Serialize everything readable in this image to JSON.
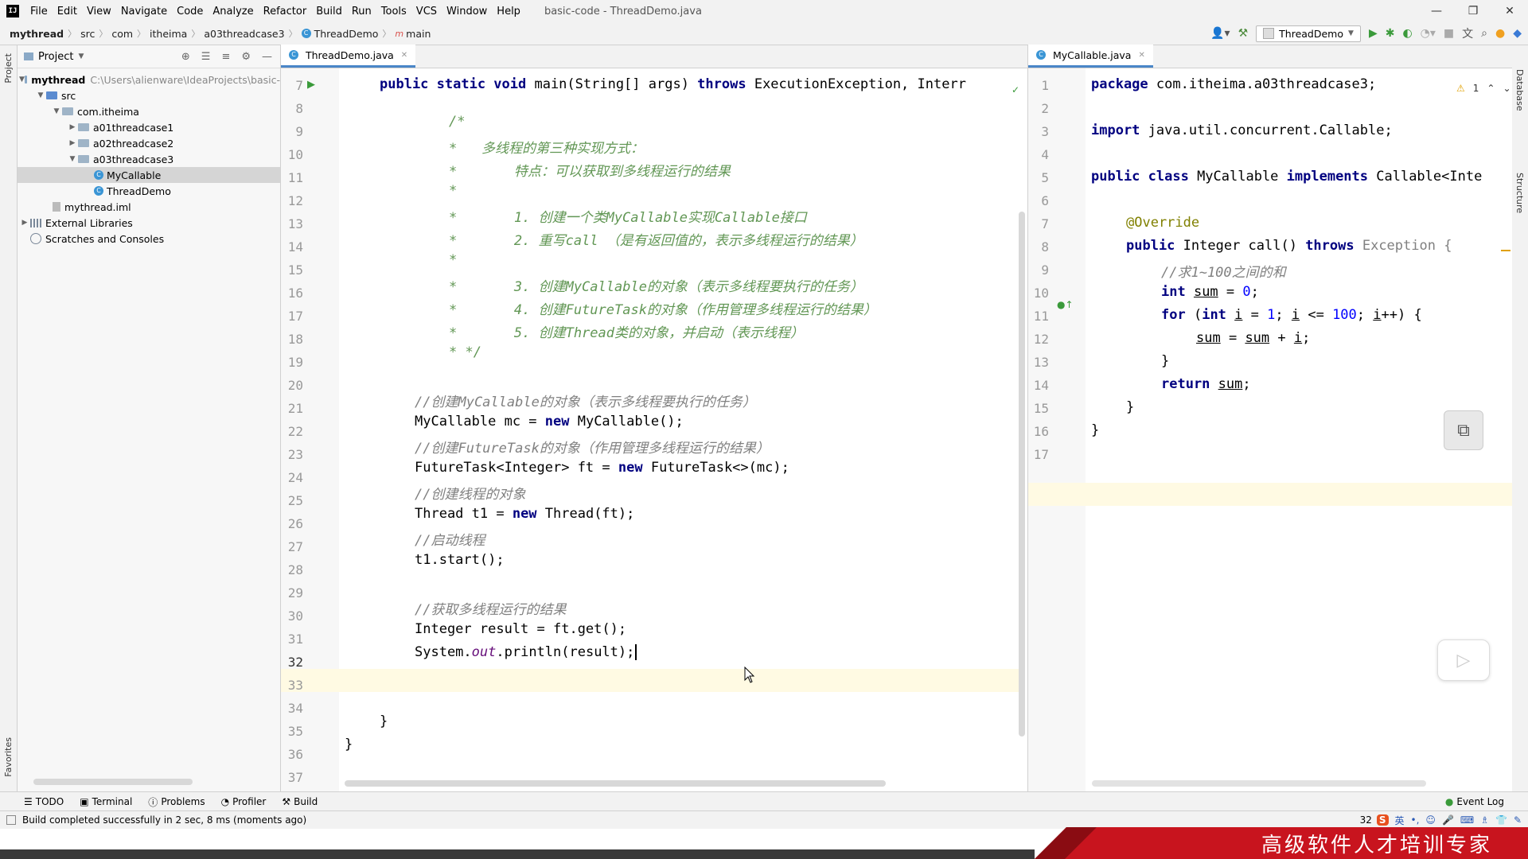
{
  "menubar": {
    "items": [
      "File",
      "Edit",
      "View",
      "Navigate",
      "Code",
      "Analyze",
      "Refactor",
      "Build",
      "Run",
      "Tools",
      "VCS",
      "Window",
      "Help"
    ],
    "window_title": "basic-code - ThreadDemo.java"
  },
  "breadcrumb": [
    "mythread",
    "src",
    "com",
    "itheima",
    "a03threadcase3",
    "ThreadDemo",
    "main"
  ],
  "run_config": "ThreadDemo",
  "project": {
    "title": "Project",
    "tree": [
      {
        "label": "mythread",
        "path": "C:\\Users\\alienware\\IdeaProjects\\basic-"
      },
      {
        "label": "src"
      },
      {
        "label": "com.itheima"
      },
      {
        "label": "a01threadcase1"
      },
      {
        "label": "a02threadcase2"
      },
      {
        "label": "a03threadcase3"
      },
      {
        "label": "MyCallable"
      },
      {
        "label": "ThreadDemo"
      },
      {
        "label": "mythread.iml"
      },
      {
        "label": "External Libraries"
      },
      {
        "label": "Scratches and Consoles"
      }
    ]
  },
  "left_editor": {
    "tab": "ThreadDemo.java",
    "line_numbers": [
      "7",
      "8",
      "9",
      "10",
      "11",
      "12",
      "13",
      "14",
      "15",
      "16",
      "17",
      "18",
      "19",
      "20",
      "21",
      "22",
      "23",
      "24",
      "25",
      "26",
      "27",
      "28",
      "29",
      "30",
      "31",
      "32",
      "33",
      "34",
      "35",
      "36",
      "37"
    ],
    "lines": {
      "l7a": "public static void ",
      "l7b": "main(String[] args) ",
      "l7c": "throws ",
      "l7d": "ExecutionException, Interr",
      "l9": "/*",
      "l10": "*   多线程的第三种实现方式：",
      "l11": "*       特点：可以获取到多线程运行的结果",
      "l12": "*",
      "l13": "*       1. 创建一个类MyCallable实现Callable接口",
      "l14": "*       2. 重写call （是有返回值的，表示多线程运行的结果）",
      "l15": "*",
      "l16": "*       3. 创建MyCallable的对象（表示多线程要执行的任务）",
      "l17": "*       4. 创建FutureTask的对象（作用管理多线程运行的结果）",
      "l18": "*       5. 创建Thread类的对象，并启动（表示线程）",
      "l19": "* */",
      "l21": "//创建MyCallable的对象（表示多线程要执行的任务）",
      "l22a": "MyCallable mc = ",
      "l22b": "new ",
      "l22c": "MyCallable();",
      "l23": "//创建FutureTask的对象（作用管理多线程运行的结果）",
      "l24a": "FutureTask<Integer> ft = ",
      "l24b": "new ",
      "l24c": "FutureTask<>(mc);",
      "l25": "//创建线程的对象",
      "l26a": "Thread t1 = ",
      "l26b": "new ",
      "l26c": "Thread(ft);",
      "l27": "//启动线程",
      "l28": "t1.start();",
      "l30": "//获取多线程运行的结果",
      "l31": "Integer result = ft.get();",
      "l32a": "System.",
      "l32b": "out",
      "l32c": ".println(result);",
      "l35": "}",
      "l36": "}"
    }
  },
  "right_editor": {
    "tab": "MyCallable.java",
    "warning_count": "1",
    "line_numbers": [
      "1",
      "2",
      "3",
      "4",
      "5",
      "6",
      "7",
      "8",
      "9",
      "10",
      "11",
      "12",
      "13",
      "14",
      "15",
      "16",
      "17"
    ],
    "lines": {
      "l1a": "package ",
      "l1b": "com.itheima.a03threadcase3;",
      "l3a": "import ",
      "l3b": "java.util.concurrent.Callable;",
      "l5a": "public class ",
      "l5b": "MyCallable ",
      "l5c": "implements ",
      "l5d": "Callable<Inte",
      "l7": "@Override",
      "l8a": "public ",
      "l8b": "Integer call() ",
      "l8c": "throws ",
      "l8d": "Exception {",
      "l9": "//求1~100之间的和",
      "l10a": "int ",
      "l10b": "sum",
      "l10c": " = ",
      "l10d": "0",
      "l10e": ";",
      "l11a": "for ",
      "l11b": "(",
      "l11c": "int ",
      "l11d": "i",
      "l11e": " = ",
      "l11f": "1",
      "l11g": "; ",
      "l11h": "i",
      "l11i": " <= ",
      "l11j": "100",
      "l11k": "; ",
      "l11l": "i",
      "l11m": "++) {",
      "l12a": "sum",
      "l12b": " = ",
      "l12c": "sum",
      "l12d": " + ",
      "l12e": "i",
      "l12f": ";",
      "l13": "}",
      "l14a": "return ",
      "l14b": "sum",
      "l14c": ";",
      "l15": "}",
      "l16": "}"
    }
  },
  "bottom_tabs": [
    "TODO",
    "Terminal",
    "Problems",
    "Profiler",
    "Build"
  ],
  "event_log": "Event Log",
  "status_text": "Build completed successfully in 2 sec, 8 ms (moments ago)",
  "status_right": "32",
  "ime_label": "英",
  "banner_text": "高级软件人才培训专家",
  "side_labels": {
    "project": "Project",
    "favorites": "Favorites",
    "database": "Database",
    "structure": "Structure"
  }
}
